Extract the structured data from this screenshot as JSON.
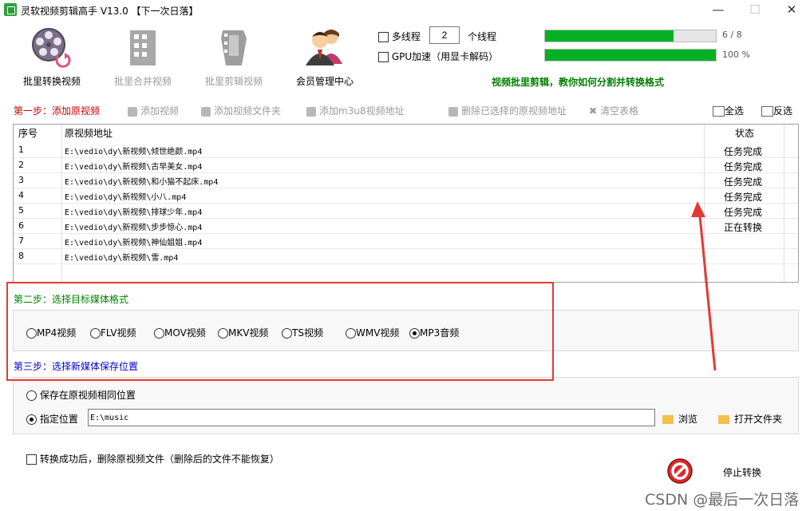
{
  "window": {
    "title": "灵软视频剪辑高手 V13.0  【下一次日落】",
    "minimize": "—",
    "maximize": "☐",
    "close": "✕"
  },
  "toolbar": [
    {
      "label": "批里转换视频",
      "enabled": true
    },
    {
      "label": "批里合并视频",
      "enabled": false
    },
    {
      "label": "批里剪辑视频",
      "enabled": false
    },
    {
      "label": "会员管理中心",
      "enabled": true
    }
  ],
  "options": {
    "multithread_label": "多线程",
    "thread_count": "2",
    "thread_unit": "个线程",
    "gpu_label": "GPU加速（用显卡解码）",
    "progress1_text": "6 / 8",
    "progress1_value": 0.75,
    "progress2_text": "100 %",
    "progress2_value": 1.0,
    "promo": "视频批里剪辑，教你如何分割并转换格式"
  },
  "step1": {
    "title": "第一步：添加原视频",
    "add_video": "添加视频",
    "add_folder": "添加视频文件夹",
    "add_m3u8": "添加m3u8视频地址",
    "delete_selected": "删除已选择的原视频地址",
    "clear_table": "清空表格",
    "select_all": "全选",
    "invert": "反选"
  },
  "table": {
    "headers": {
      "index": "序号",
      "path": "原视频地址",
      "status": "状态"
    },
    "rows": [
      {
        "index": "1",
        "path": "E:\\vedio\\dy\\新视频\\倾世绝颜.mp4",
        "status": "任务完成"
      },
      {
        "index": "2",
        "path": "E:\\vedio\\dy\\新视频\\古早美女.mp4",
        "status": "任务完成"
      },
      {
        "index": "3",
        "path": "E:\\vedio\\dy\\新视频\\和小猫不起床.mp4",
        "status": "任务完成"
      },
      {
        "index": "4",
        "path": "E:\\vedio\\dy\\新视频\\小八.mp4",
        "status": "任务完成"
      },
      {
        "index": "5",
        "path": "E:\\vedio\\dy\\新视频\\排球少年.mp4",
        "status": "任务完成"
      },
      {
        "index": "6",
        "path": "E:\\vedio\\dy\\新视频\\步步惊心.mp4",
        "status": "正在转换"
      },
      {
        "index": "7",
        "path": "E:\\vedio\\dy\\新视频\\神仙姐姐.mp4",
        "status": ""
      },
      {
        "index": "8",
        "path": "E:\\vedio\\dy\\新视频\\雪.mp4",
        "status": ""
      }
    ]
  },
  "step2": {
    "title": "第二步：选择目标媒体格式",
    "formats": [
      "MP4视频",
      "FLV视频",
      "MOV视频",
      "MKV视频",
      "TS视频",
      "WMV视频",
      "MP3音频"
    ],
    "selected": "MP3音频"
  },
  "step3": {
    "title": "第三步：选择新媒体保存位置",
    "same_location": "保存在原视频相同位置",
    "specify": "指定位置",
    "path": "E:\\music",
    "browse": "浏览",
    "open_folder": "打开文件夹"
  },
  "footer": {
    "delete_after": "转换成功后，删除原视频文件（删除后的文件不能恢复）",
    "stop": "停止转换",
    "watermark": "CSDN @最后一次日落"
  },
  "colors": {
    "accent_red": "#e53935",
    "step1": "#cc0000",
    "step2": "#008000",
    "step3": "#0000cc",
    "progress": "#06b025"
  }
}
